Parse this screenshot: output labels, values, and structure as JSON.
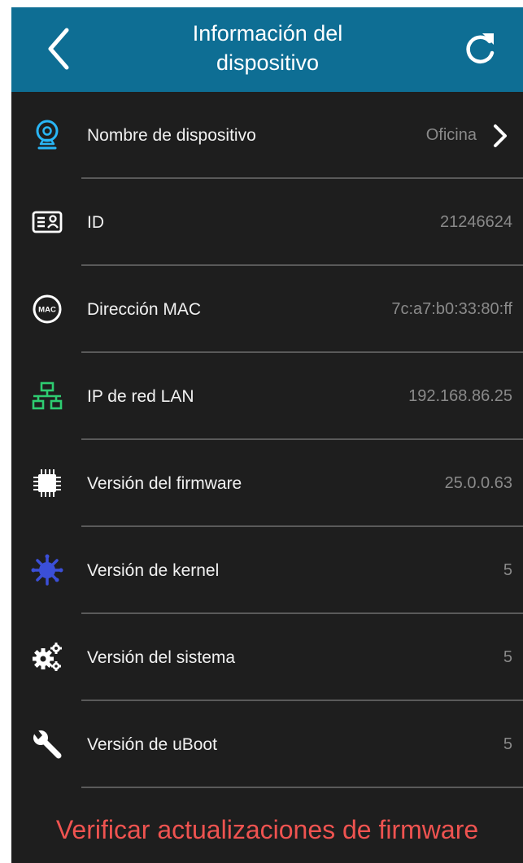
{
  "header": {
    "title_line1": "Información del",
    "title_line2": "dispositivo"
  },
  "items": [
    {
      "label": "Nombre de dispositivo",
      "value": "Oficina",
      "icon": "webcam-icon",
      "icon_color": "#29b6f6"
    },
    {
      "label": "ID",
      "value": "21246624",
      "icon": "id-card-icon",
      "icon_color": "#ffffff"
    },
    {
      "label": "Dirección MAC",
      "value": "7c:a7:b0:33:80:ff",
      "icon": "mac-badge-icon",
      "icon_color": "#ffffff",
      "icon_text": "MAC"
    },
    {
      "label": "IP de red LAN",
      "value": "192.168.86.25",
      "icon": "network-icon",
      "icon_color": "#2ecc71"
    },
    {
      "label": "Versión del firmware",
      "value": "25.0.0.63",
      "icon": "chip-icon",
      "icon_color": "#ffffff"
    },
    {
      "label": "Versión de kernel",
      "value": "5",
      "icon": "kernel-icon",
      "icon_color": "#3b4fd8"
    },
    {
      "label": "Versión del sistema",
      "value": "5",
      "icon": "gears-icon",
      "icon_color": "#ffffff"
    },
    {
      "label": "Versión de uBoot",
      "value": "5",
      "icon": "wrench-icon",
      "icon_color": "#ffffff"
    }
  ],
  "update_link": "Verificar actualizaciones de firmware",
  "colors": {
    "header_bg": "#0e6e94",
    "background": "#1e1e1e",
    "accent_red": "#ef5350",
    "value_gray": "#8a8a8a"
  }
}
